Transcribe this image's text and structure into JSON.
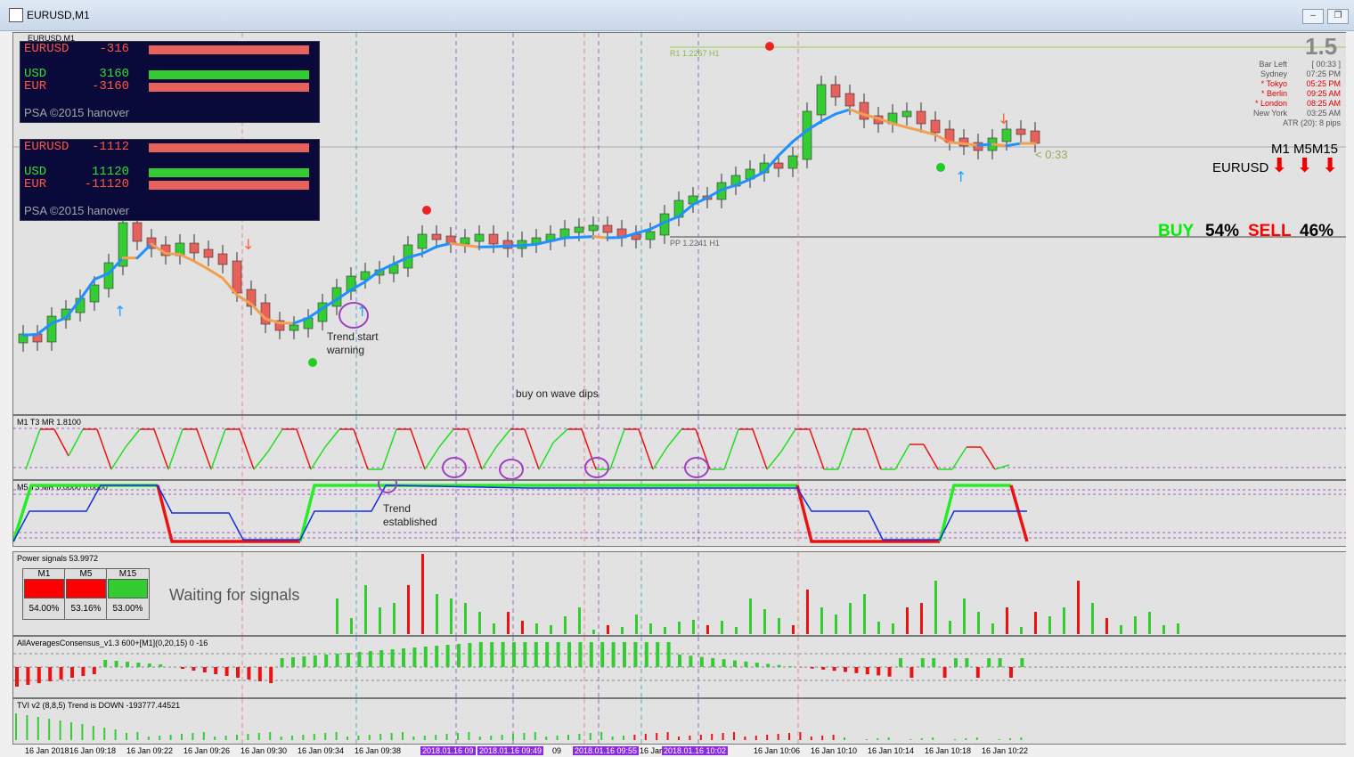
{
  "window": {
    "title": "EURUSD,M1",
    "chart_caption": "EURUSD,M1"
  },
  "psa_boxes": [
    {
      "pair": "EURUSD",
      "pair_value": "-316",
      "usd_label": "USD",
      "usd_value": "3160",
      "eur_label": "EUR",
      "eur_value": "-3160",
      "credit": "PSA ©2015 hanover"
    },
    {
      "pair": "EURUSD",
      "pair_value": "-1112",
      "usd_label": "USD",
      "usd_value": "11120",
      "eur_label": "EUR",
      "eur_value": "-11120",
      "credit": "PSA ©2015 hanover"
    }
  ],
  "levels": {
    "r1": "R1 1.2267 H1",
    "pp": "PP 1.2241 H1"
  },
  "info": {
    "big": "1.5",
    "bar_left": "Bar Left",
    "bar_left_val": "[ 00:33 ]",
    "sydney": "Sydney",
    "sydney_t": "07:25 PM",
    "tokyo": "* Tokyo",
    "tokyo_t": "05:25 PM",
    "berlin": "* Berlin",
    "berlin_t": "09:25 AM",
    "london": "* London",
    "london_t": "08:25 AM",
    "newyork": "New York",
    "newyork_t": "03:25 AM",
    "atr": "ATR (20): 8 pips",
    "countdown": "< 0:33",
    "tf_header": "M1 M5M15",
    "symbol": "EURUSD"
  },
  "signal": {
    "buy": "BUY",
    "buy_pct": "54%",
    "sell": "SELL",
    "sell_pct": "46%"
  },
  "annotations": {
    "trend_start": "Trend start\nwarning",
    "buy_dips": "buy on wave dips",
    "trend_established": "Trend\nestablished",
    "waiting": "Waiting for signals"
  },
  "indicators": {
    "m1": "M1  T3 MR  1.8100",
    "m5": "M5  T3 MR  0.0000 0.0000",
    "power": "Power signals 53.9972",
    "consensus": "AllAveragesConsensus_v1.3 600+[M1](0,20,15) 0 -16",
    "tvi": "TVI v2 (8,8,5) Trend is DOWN -193777.44521"
  },
  "power_boxes": [
    {
      "tf": "M1",
      "pct": "54.00%",
      "color": "#ff0000"
    },
    {
      "tf": "M5",
      "pct": "53.16%",
      "color": "#ff0000"
    },
    {
      "tf": "M15",
      "pct": "53.00%",
      "color": "#33cc33"
    }
  ],
  "time_axis": [
    "16 Jan 2018",
    "16 Jan 09:18",
    "16 Jan 09:22",
    "16 Jan 09:26",
    "16 Jan 09:30",
    "16 Jan 09:34",
    "16 Jan 09:38",
    "2018.01.16 09",
    "2018.01.16 09:49",
    "09",
    "2018.01.16 09:55",
    "16 Jan",
    "2018.01.16 10:02",
    "16 Jan 10:06",
    "16 Jan 10:10",
    "16 Jan 10:14",
    "16 Jan 10:18",
    "16 Jan 10:22"
  ],
  "colors": {
    "bull": "#33cc33",
    "bear": "#e8605a",
    "ma_up": "#1e90ff",
    "ma_down": "#f0a050",
    "buy": "#00ff00",
    "sell": "#ff0000"
  }
}
